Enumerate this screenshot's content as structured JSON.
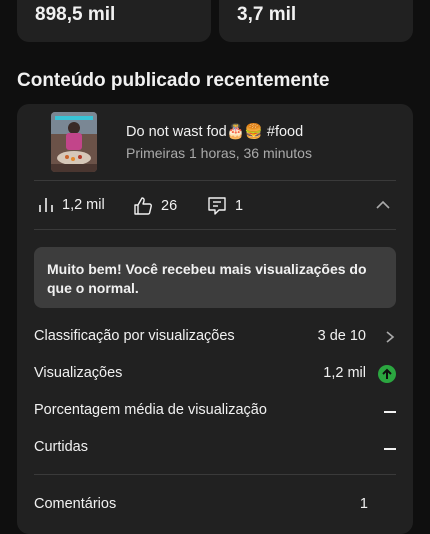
{
  "stats": {
    "left_value": "898,5 mil",
    "right_value": "3,7 mil"
  },
  "section": {
    "title": "Conteúdo publicado recentemente"
  },
  "video": {
    "title": "Do not wast fod🎂🍔 #food",
    "subtitle": "Primeiras 1 horas, 36 minutos"
  },
  "metrics": {
    "views": "1,2 mil",
    "likes": "26",
    "comments": "1"
  },
  "alert": {
    "text": "Muito bem! Você recebeu mais visualizações do que o normal."
  },
  "rows": {
    "ranking_label": "Classificação por visualizações",
    "ranking_value": "3 de 10",
    "views_label": "Visualizações",
    "views_value": "1,2 mil",
    "avg_pct_label": "Porcentagem média de visualização",
    "likes_label": "Curtidas",
    "comments_label": "Comentários",
    "comments_value": "1"
  },
  "colors": {
    "background": "#0f0f0f",
    "card": "#212121",
    "alert_bg": "#3d3d3d",
    "up_indicator": "#2ba640"
  }
}
